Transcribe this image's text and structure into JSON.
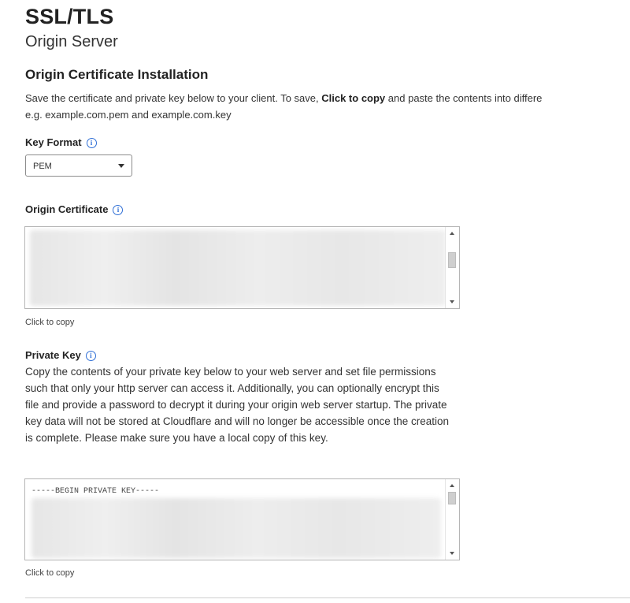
{
  "header": {
    "title": "SSL/TLS",
    "subtitle": "Origin Server"
  },
  "installation": {
    "title": "Origin Certificate Installation",
    "desc_pre": "Save the certificate and private key below to your client. To save, ",
    "desc_bold": "Click to copy",
    "desc_post": " and paste the contents into differe",
    "desc_line2": "e.g. example.com.pem and example.com.key"
  },
  "key_format": {
    "label": "Key Format",
    "selected": "PEM",
    "info_icon": "info-circle-icon"
  },
  "origin_certificate": {
    "label": "Origin Certificate",
    "info_icon": "info-circle-icon",
    "copy_label": "Click to copy"
  },
  "private_key": {
    "label": "Private Key",
    "info_icon": "info-circle-icon",
    "description": "Copy the contents of your private key below to your web server and set file permissions such that only your http server can access it. Additionally, you can optionally encrypt this file and provide a password to decrypt it during your origin web server startup. The private key data will not be stored at Cloudflare and will no longer be accessible once the creation is complete. Please make sure you have a local copy of this key.",
    "first_line": "-----BEGIN PRIVATE KEY-----",
    "copy_label": "Click to copy"
  },
  "colors": {
    "accent": "#2f6fd6",
    "text": "#222222",
    "border": "#b5b5b5"
  }
}
